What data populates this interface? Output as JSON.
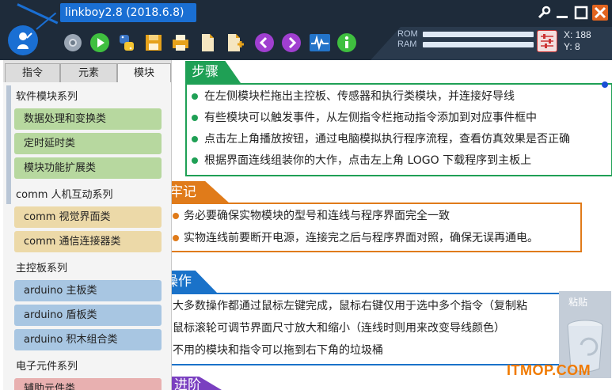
{
  "app": {
    "title": "linkboy2.8 (2018.6.8)"
  },
  "toolbar": {
    "items": [
      {
        "name": "chrome-icon"
      },
      {
        "name": "play-icon"
      },
      {
        "name": "python-icon"
      },
      {
        "name": "save-icon"
      },
      {
        "name": "print-icon"
      },
      {
        "name": "new-file-icon"
      },
      {
        "name": "add-file-icon"
      },
      {
        "name": "back-icon"
      },
      {
        "name": "forward-icon"
      },
      {
        "name": "waveform-icon"
      },
      {
        "name": "info-icon"
      }
    ]
  },
  "window_controls": [
    "wrench-icon",
    "minimize-icon",
    "maximize-icon",
    "close-icon"
  ],
  "monitor": {
    "rom_label": "ROM",
    "ram_label": "RAM",
    "x_label": "X: 188",
    "y_label": "Y: 8"
  },
  "left_panel": {
    "tabs": [
      {
        "label": "指令",
        "active": false
      },
      {
        "label": "元素",
        "active": false
      },
      {
        "label": "模块",
        "active": true
      }
    ],
    "groups": [
      {
        "title": "软件模块系列",
        "items": [
          "数据处理和变换类",
          "定时延时类",
          "模块功能扩展类"
        ],
        "color": "#b7d89f"
      },
      {
        "title": "comm 人机互动系列",
        "items": [
          "comm 视觉界面类",
          "comm 通信连接器类"
        ],
        "color": "#ecd9a8"
      },
      {
        "title": "主控板系列",
        "items": [
          "arduino 主板类",
          "arduino 盾板类",
          "arduino 积木组合类"
        ],
        "color": "#a8c6e2"
      },
      {
        "title": "电子元件系列",
        "items": [
          "辅助元件类"
        ],
        "color": "#e8b0b0"
      }
    ]
  },
  "content": {
    "steps": {
      "title": "步骤",
      "color": "#1fa055",
      "lines": [
        "在左侧模块栏拖出主控板、传感器和执行类模块，并连接好导线",
        "有些模块可以触发事件，从左侧指令栏拖动指令添加到对应事件框中",
        "点击左上角播放按钮，通过电脑模拟执行程序流程，查看仿真效果是否正确",
        "根据界面连线组装你的大作，点击左上角 LOGO 下载程序到主板上"
      ]
    },
    "remember": {
      "title": "牢记",
      "color": "#e07b1a",
      "lines": [
        "务必要确保实物模块的型号和连线与程序界面完全一致",
        "实物连线前要断开电源，连接完之后与程序界面对照，确保无误再通电。"
      ]
    },
    "operate": {
      "title": "操作",
      "color": "#1a72c9",
      "lines": [
        "大多数操作都通过鼠标左键完成，鼠标右键仅用于选中多个指令（复制粘",
        "鼠标滚轮可调节界面尺寸放大和缩小（连线时则用来改变导线颜色）",
        "不用的模块和指令可以拖到右下角的垃圾桶"
      ]
    },
    "advanced": {
      "title": "进阶",
      "color": "#7a3fc0"
    }
  },
  "paste_panel": {
    "label": "粘贴"
  },
  "watermark": {
    "text": "ITMOP.COM"
  }
}
